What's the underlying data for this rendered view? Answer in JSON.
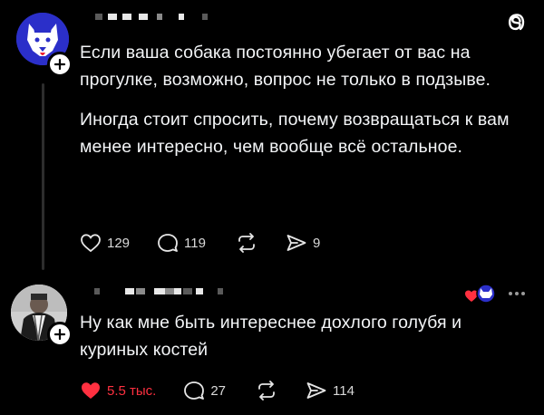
{
  "post1": {
    "text_p1": "Если ваша собака постоянно убегает от вас на прогулке, возможно, вопрос не только в подзыве.",
    "text_p2": "Иногда стоит спросить, почему возвращаться к вам менее интересно, чем вообще всё остальное.",
    "likes": "129",
    "comments": "119",
    "shares": "9"
  },
  "reply": {
    "text": "Ну как мне быть интереснее дохлого голубя и куриных костей",
    "likes": "5.5 тыс.",
    "comments": "27",
    "shares": "114"
  },
  "icons": {
    "threads": "threads-logo-icon",
    "heart": "heart-icon",
    "comment": "comment-bubble-icon",
    "repost": "repost-icon",
    "share": "send-icon",
    "more": "more-dots-icon",
    "follow": "plus-icon"
  },
  "colors": {
    "like_red": "#ff3040",
    "brand_blue": "#2b2fc9"
  }
}
